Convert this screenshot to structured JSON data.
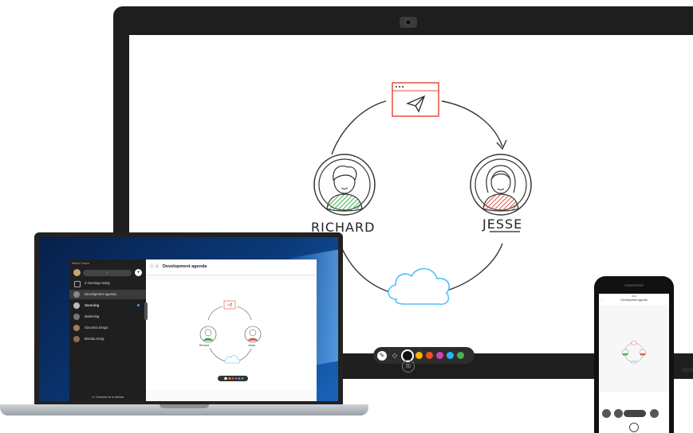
{
  "hub": {
    "names": {
      "left": "RICHARD",
      "right": "JESSE"
    },
    "toolbar": {
      "tools": [
        {
          "icon": "pen-icon"
        },
        {
          "icon": "eraser-icon"
        }
      ],
      "colors": [
        "#111111",
        "#f5b400",
        "#f25022",
        "#d63fb8",
        "#29b6f6",
        "#4caf50"
      ],
      "selected_color_index": 0
    }
  },
  "laptop": {
    "app": {
      "brand": "Webex Teams",
      "search_icon": "search-icon",
      "header": {
        "title": "Development agenda"
      },
      "sidebar": {
        "items": [
          {
            "label": "2 meetings today",
            "icon": "calendar-icon"
          },
          {
            "label": "Development agenda",
            "icon": "whiteboard-icon",
            "active": true
          },
          {
            "label": "Sourcing",
            "icon": "avatar",
            "bold": true,
            "unread": true
          },
          {
            "label": "Marketing",
            "icon": "avatar"
          },
          {
            "label": "Giacomo Drago",
            "icon": "avatar"
          },
          {
            "label": "Brenda Song",
            "icon": "avatar"
          }
        ],
        "connect": "Connect to a device"
      },
      "canvas_names": {
        "left": "Richard",
        "right": "Jesse"
      }
    }
  },
  "phone": {
    "status_time": "9:41",
    "title": "Development agenda"
  },
  "colors": {
    "accent": "#3aa0ff",
    "send_box": "#e84c3d",
    "cloud": "#4fc3f7",
    "hatch_green": "#3db24a",
    "hatch_red": "#e05a4a"
  }
}
